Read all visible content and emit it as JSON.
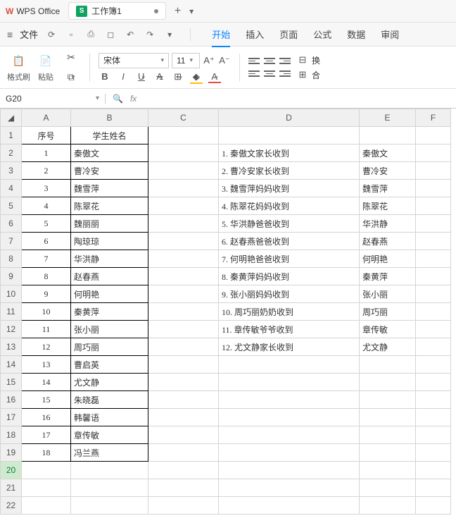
{
  "app": {
    "logo": "W",
    "name": "WPS Office"
  },
  "doc": {
    "icon": "S",
    "title": "工作簿1"
  },
  "menubar": {
    "file": "文件",
    "tabs": [
      "开始",
      "插入",
      "页面",
      "公式",
      "数据",
      "审阅"
    ],
    "active_tab": "开始"
  },
  "ribbon": {
    "format_brush": "格式刷",
    "paste": "粘贴",
    "font": "宋体",
    "size": "11",
    "replace": "换",
    "merge": "合"
  },
  "formula": {
    "namebox": "G20",
    "fx": "fx"
  },
  "columns": [
    "A",
    "B",
    "C",
    "D",
    "E",
    "F"
  ],
  "header_row": {
    "a": "序号",
    "b": "学生姓名"
  },
  "students": [
    {
      "n": "1",
      "name": "秦傲文"
    },
    {
      "n": "2",
      "name": "曹冷安"
    },
    {
      "n": "3",
      "name": "魏雪萍"
    },
    {
      "n": "4",
      "name": "陈翠花"
    },
    {
      "n": "5",
      "name": "魏丽丽"
    },
    {
      "n": "6",
      "name": "陶琼琼"
    },
    {
      "n": "7",
      "name": "华洪静"
    },
    {
      "n": "8",
      "name": "赵春燕"
    },
    {
      "n": "9",
      "name": "何明艳"
    },
    {
      "n": "10",
      "name": "秦黄萍"
    },
    {
      "n": "11",
      "name": "张小丽"
    },
    {
      "n": "12",
      "name": "周巧丽"
    },
    {
      "n": "13",
      "name": "曹启英"
    },
    {
      "n": "14",
      "name": "尤文静"
    },
    {
      "n": "15",
      "name": "朱晓磊"
    },
    {
      "n": "16",
      "name": "韩馨语"
    },
    {
      "n": "17",
      "name": "章传敏"
    },
    {
      "n": "18",
      "name": "冯兰燕"
    }
  ],
  "records": [
    {
      "i": "1.",
      "text": "秦傲文家长收到",
      "e": "秦傲文"
    },
    {
      "i": "2.",
      "text": "曹冷安家长收到",
      "e": "曹冷安"
    },
    {
      "i": "3.",
      "text": "魏雪萍妈妈收到",
      "e": "魏雪萍"
    },
    {
      "i": "4.",
      "text": "陈翠花妈妈收到",
      "e": "陈翠花"
    },
    {
      "i": "5.",
      "text": "华洪静爸爸收到",
      "e": "华洪静"
    },
    {
      "i": "6.",
      "text": "赵春燕爸爸收到",
      "e": "赵春燕"
    },
    {
      "i": "7.",
      "text": "何明艳爸爸收到",
      "e": "何明艳"
    },
    {
      "i": "8.",
      "text": "秦黄萍妈妈收到",
      "e": "秦黄萍"
    },
    {
      "i": "9.",
      "text": "张小丽妈妈收到",
      "e": "张小丽"
    },
    {
      "i": "10.",
      "text": "周巧丽奶奶收到",
      "e": "周巧丽"
    },
    {
      "i": "11.",
      "text": "章传敏爷爷收到",
      "e": "章传敏"
    },
    {
      "i": "12.",
      "text": "尤文静家长收到",
      "e": "尤文静"
    }
  ],
  "total_rows": 22,
  "active_row": 20
}
